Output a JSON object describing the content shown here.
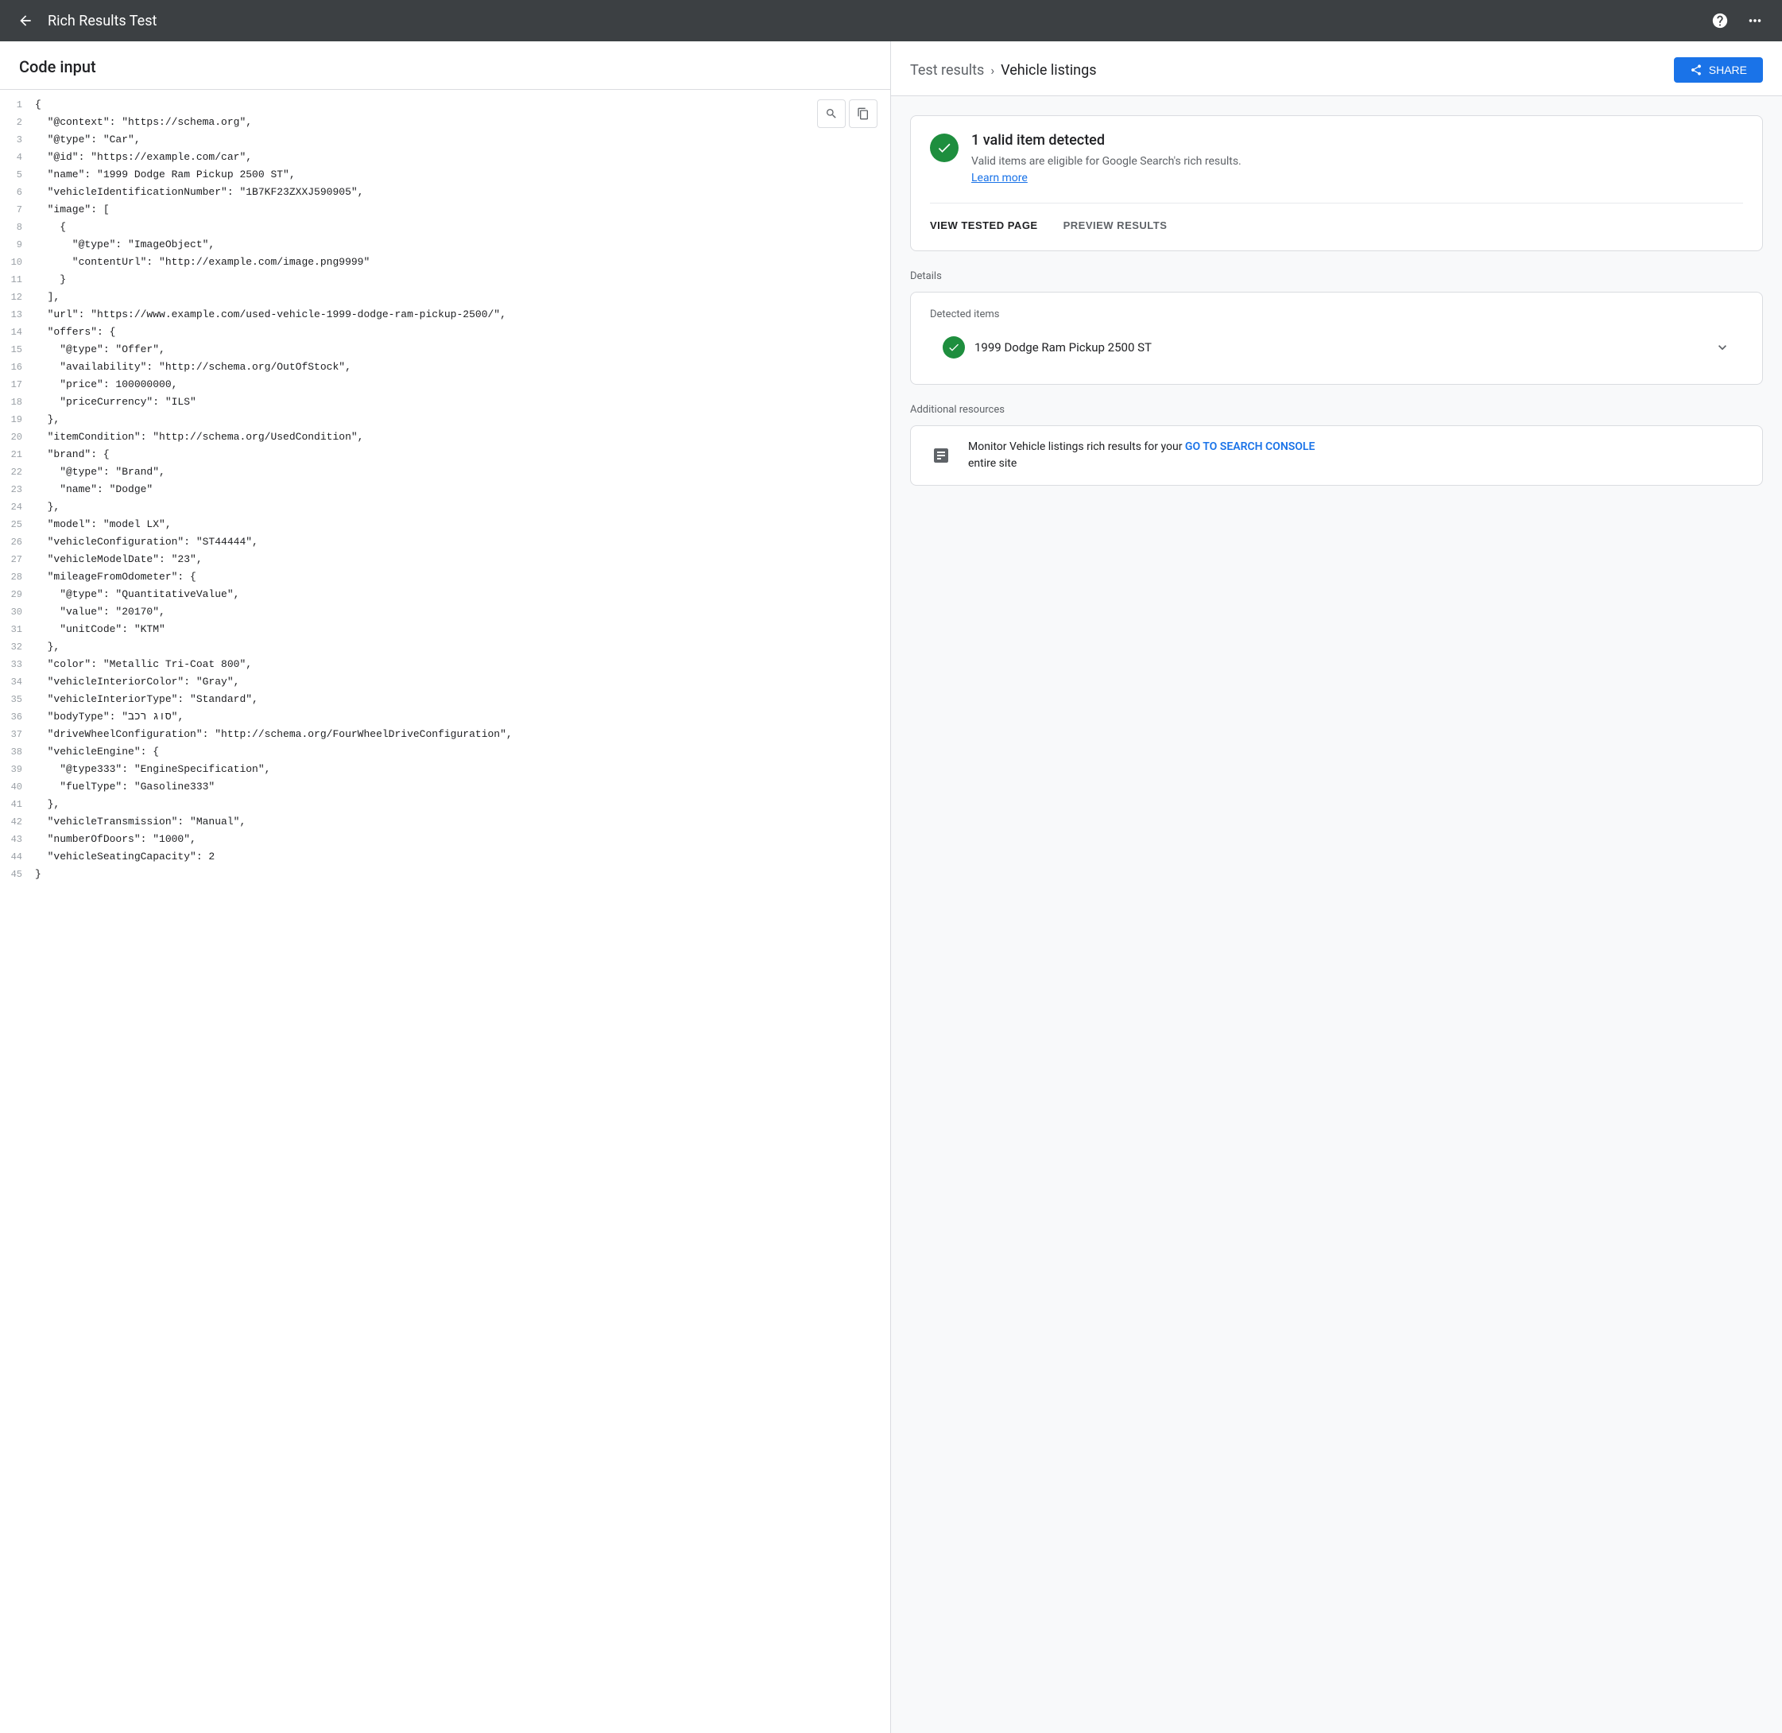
{
  "app": {
    "title": "Rich Results Test",
    "back_label": "←"
  },
  "nav": {
    "help_icon": "?",
    "grid_icon": "⠿"
  },
  "left_panel": {
    "header": "Code input",
    "search_icon": "🔍",
    "copy_icon": "⧉",
    "code_lines": [
      {
        "num": 1,
        "content": "{"
      },
      {
        "num": 2,
        "content": "  \"@context\": \"https://schema.org\","
      },
      {
        "num": 3,
        "content": "  \"@type\": \"Car\","
      },
      {
        "num": 4,
        "content": "  \"@id\": \"https://example.com/car\","
      },
      {
        "num": 5,
        "content": "  \"name\": \"1999 Dodge Ram Pickup 2500 ST\","
      },
      {
        "num": 6,
        "content": "  \"vehicleIdentificationNumber\": \"1B7KF23ZXXJ590905\","
      },
      {
        "num": 7,
        "content": "  \"image\": ["
      },
      {
        "num": 8,
        "content": "    {"
      },
      {
        "num": 9,
        "content": "      \"@type\": \"ImageObject\","
      },
      {
        "num": 10,
        "content": "      \"contentUrl\": \"http://example.com/image.png9999\""
      },
      {
        "num": 11,
        "content": "    }"
      },
      {
        "num": 12,
        "content": "  ],"
      },
      {
        "num": 13,
        "content": "  \"url\": \"https://www.example.com/used-vehicle-1999-dodge-ram-pickup-2500/\","
      },
      {
        "num": 14,
        "content": "  \"offers\": {"
      },
      {
        "num": 15,
        "content": "    \"@type\": \"Offer\","
      },
      {
        "num": 16,
        "content": "    \"availability\": \"http://schema.org/OutOfStock\","
      },
      {
        "num": 17,
        "content": "    \"price\": 100000000,"
      },
      {
        "num": 18,
        "content": "    \"priceCurrency\": \"ILS\""
      },
      {
        "num": 19,
        "content": "  },"
      },
      {
        "num": 20,
        "content": "  \"itemCondition\": \"http://schema.org/UsedCondition\","
      },
      {
        "num": 21,
        "content": "  \"brand\": {"
      },
      {
        "num": 22,
        "content": "    \"@type\": \"Brand\","
      },
      {
        "num": 23,
        "content": "    \"name\": \"Dodge\""
      },
      {
        "num": 24,
        "content": "  },"
      },
      {
        "num": 25,
        "content": "  \"model\": \"model LX\","
      },
      {
        "num": 26,
        "content": "  \"vehicleConfiguration\": \"ST44444\","
      },
      {
        "num": 27,
        "content": "  \"vehicleModelDate\": \"23\","
      },
      {
        "num": 28,
        "content": "  \"mileageFromOdometer\": {"
      },
      {
        "num": 29,
        "content": "    \"@type\": \"QuantitativeValue\","
      },
      {
        "num": 30,
        "content": "    \"value\": \"20170\","
      },
      {
        "num": 31,
        "content": "    \"unitCode\": \"KTM\""
      },
      {
        "num": 32,
        "content": "  },"
      },
      {
        "num": 33,
        "content": "  \"color\": \"Metallic Tri-Coat 800\","
      },
      {
        "num": 34,
        "content": "  \"vehicleInteriorColor\": \"Gray\","
      },
      {
        "num": 35,
        "content": "  \"vehicleInteriorType\": \"Standard\","
      },
      {
        "num": 36,
        "content": "  \"bodyType\": \"סוג רכב\","
      },
      {
        "num": 37,
        "content": "  \"driveWheelConfiguration\": \"http://schema.org/FourWheelDriveConfiguration\","
      },
      {
        "num": 38,
        "content": "  \"vehicleEngine\": {"
      },
      {
        "num": 39,
        "content": "    \"@type333\": \"EngineSpecification\","
      },
      {
        "num": 40,
        "content": "    \"fuelType\": \"Gasoline333\""
      },
      {
        "num": 41,
        "content": "  },"
      },
      {
        "num": 42,
        "content": "  \"vehicleTransmission\": \"Manual\","
      },
      {
        "num": 43,
        "content": "  \"numberOfDoors\": \"1000\","
      },
      {
        "num": 44,
        "content": "  \"vehicleSeatingCapacity\": 2"
      },
      {
        "num": 45,
        "content": "}"
      }
    ]
  },
  "right_panel": {
    "breadcrumb": {
      "test_results": "Test results",
      "chevron": "›",
      "current": "Vehicle listings"
    },
    "share_button": "SHARE",
    "valid_item": {
      "count": "1 valid item detected",
      "description": "Valid items are eligible for Google Search's rich results.",
      "learn_more": "Learn more"
    },
    "view_tested_page": "VIEW TESTED PAGE",
    "preview_results": "PREVIEW RESULTS",
    "details_label": "Details",
    "detected_items_label": "Detected items",
    "detected_item_name": "1999 Dodge Ram Pickup 2500 ST",
    "additional_resources_label": "Additional resources",
    "resource_text_before": "Monitor Vehicle listings rich results for your ",
    "resource_link": "GO TO SEARCH CONSOLE",
    "resource_text_after": " entire site"
  }
}
